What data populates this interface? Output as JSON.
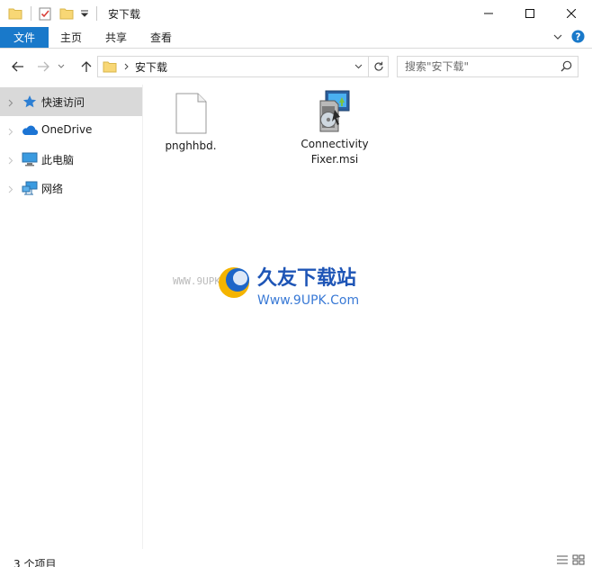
{
  "window": {
    "title": "安下载"
  },
  "ribbon": {
    "tabs": [
      {
        "label": "文件"
      },
      {
        "label": "主页"
      },
      {
        "label": "共享"
      },
      {
        "label": "查看"
      }
    ]
  },
  "address": {
    "path": [
      "安下载"
    ]
  },
  "search": {
    "placeholder": "搜索\"安下载\""
  },
  "sidebar": {
    "items": [
      {
        "label": "快速访问",
        "icon": "star-icon",
        "selected": true
      },
      {
        "label": "OneDrive",
        "icon": "cloud-icon",
        "selected": false
      },
      {
        "label": "此电脑",
        "icon": "computer-icon",
        "selected": false
      },
      {
        "label": "网络",
        "icon": "network-icon",
        "selected": false
      }
    ]
  },
  "files": [
    {
      "name": "pnghhbd.",
      "icon": "blank-file-icon"
    },
    {
      "name": "ConnectivityFixer.msi",
      "icon": "msi-installer-icon"
    }
  ],
  "status": {
    "text": "3 个项目"
  },
  "watermark": {
    "brand_cn": "久友下载站",
    "url_top": "WWW.9UPK.COM",
    "url_main": "Www.9UPK.Com"
  },
  "colors": {
    "accent": "#1979ca",
    "selected_bg": "#d9d9d9",
    "folder": "#f8d775"
  }
}
